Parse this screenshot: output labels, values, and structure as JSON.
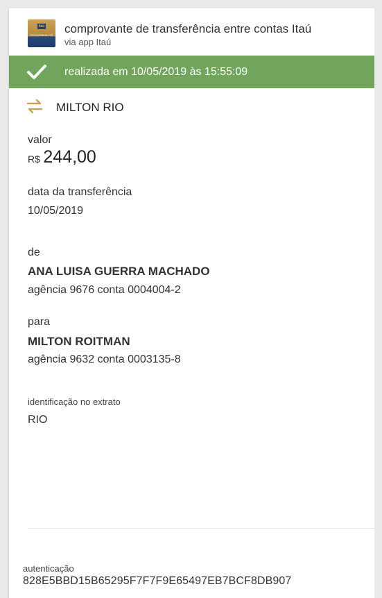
{
  "header": {
    "logo_badge": "Itaú",
    "logo_text": "PERSONNALITÉ",
    "title": "comprovante de transferência entre contas Itaú",
    "subtitle": "via app Itaú"
  },
  "status": {
    "text": "realizada em 10/05/2019 às 15:55:09",
    "icon": "check-icon",
    "color": "#71a55b"
  },
  "recipient_summary": {
    "icon": "transfer-arrows-icon",
    "name": "MILTON RIO",
    "icon_color": "#c9a25a"
  },
  "value": {
    "label": "valor",
    "currency": "R$",
    "amount": "244,00"
  },
  "date": {
    "label": "data da transferência",
    "value": "10/05/2019"
  },
  "from": {
    "label": "de",
    "name": "ANA LUISA GUERRA MACHADO",
    "account": "agência 9676 conta 0004004-2"
  },
  "to": {
    "label": "para",
    "name": "MILTON ROITMAN",
    "account": "agência 9632 conta 0003135-8"
  },
  "statement_id": {
    "label": "identificação no extrato",
    "value": "RIO"
  },
  "authentication": {
    "label": "autenticação",
    "code": "828E5BBD15B65295F7F7F9E65497EB7BCF8DB907"
  }
}
